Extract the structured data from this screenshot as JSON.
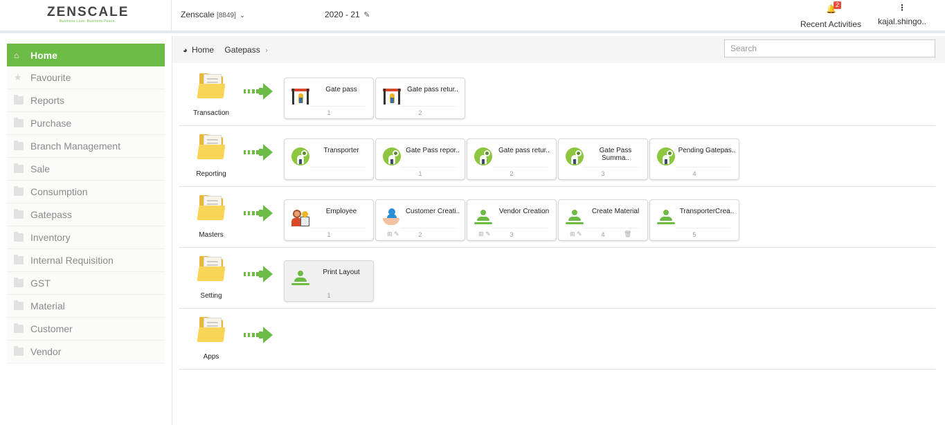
{
  "header": {
    "logo_text": "ZENSCALE",
    "logo_tagline": "Business Love. Business Peace.",
    "company": "Zenscale",
    "company_code": "[8849]",
    "year": "2020 - 21",
    "notification_count": "2",
    "recent_label": "Recent Activities",
    "user_label": "kajal.shingo.."
  },
  "sidebar": {
    "items": [
      {
        "label": "Home",
        "icon": "home-icon",
        "active": true
      },
      {
        "label": "Favourite",
        "icon": "star-icon"
      },
      {
        "label": "Reports",
        "icon": "folder-icon"
      },
      {
        "label": "Purchase",
        "icon": "folder-icon"
      },
      {
        "label": "Branch Management",
        "icon": "folder-icon"
      },
      {
        "label": "Sale",
        "icon": "folder-icon"
      },
      {
        "label": "Consumption",
        "icon": "folder-icon"
      },
      {
        "label": "Gatepass",
        "icon": "folder-icon"
      },
      {
        "label": "Inventory",
        "icon": "folder-icon"
      },
      {
        "label": "Internal Requisition",
        "icon": "folder-icon"
      },
      {
        "label": "GST",
        "icon": "folder-icon"
      },
      {
        "label": "Material",
        "icon": "folder-icon"
      },
      {
        "label": "Customer",
        "icon": "folder-icon"
      },
      {
        "label": "Vendor",
        "icon": "folder-icon"
      }
    ]
  },
  "breadcrumb": {
    "home": "Home",
    "current": "Gatepass"
  },
  "search": {
    "placeholder": "Search"
  },
  "sections": [
    {
      "label": "Transaction",
      "cards": [
        {
          "title": "Gate pass",
          "num": "1",
          "icon": "gate-icon"
        },
        {
          "title": "Gate pass retur..",
          "num": "2",
          "icon": "gate-icon"
        }
      ]
    },
    {
      "label": "Reporting",
      "cards": [
        {
          "title": "Transporter",
          "num": "",
          "icon": "report-icon"
        },
        {
          "title": "Gate Pass repor..",
          "num": "1",
          "icon": "report-icon"
        },
        {
          "title": "Gate pass retur..",
          "num": "2",
          "icon": "report-icon"
        },
        {
          "title": "Gate Pass Summa..",
          "num": "3",
          "icon": "report-icon"
        },
        {
          "title": "Pending Gatepas..",
          "num": "4",
          "icon": "report-icon"
        }
      ]
    },
    {
      "label": "Masters",
      "cards": [
        {
          "title": "Employee",
          "num": "1",
          "icon": "employee-icon"
        },
        {
          "title": "Customer Creati..",
          "num": "2",
          "icon": "customer-icon"
        },
        {
          "title": "Vendor Creation",
          "num": "3",
          "icon": "user-icon"
        },
        {
          "title": "Create Material",
          "num": "4",
          "icon": "user-icon"
        },
        {
          "title": "TransporterCrea..",
          "num": "5",
          "icon": "user-icon"
        }
      ]
    },
    {
      "label": "Setting",
      "cards": [
        {
          "title": "Print Layout",
          "num": "1",
          "icon": "user-icon"
        }
      ]
    },
    {
      "label": "Apps",
      "cards": []
    }
  ],
  "colors": {
    "accent": "#6cbb44",
    "badge": "#e74c3c"
  }
}
